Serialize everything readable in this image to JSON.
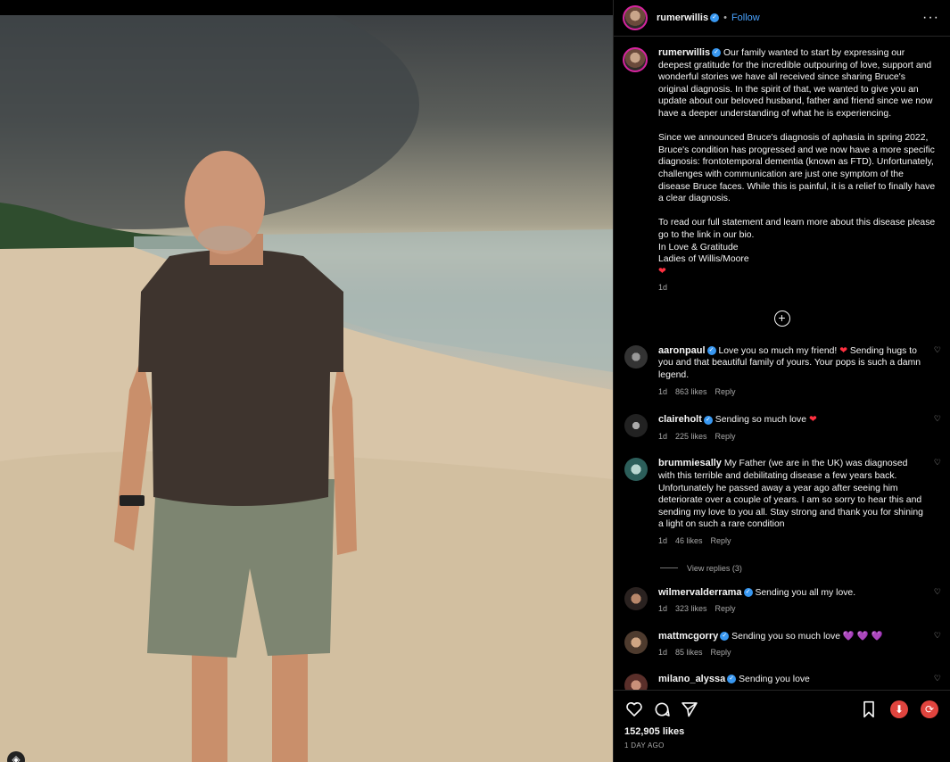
{
  "post": {
    "username": "rumerwillis",
    "follow_label": "Follow",
    "dot": "•",
    "more": "···",
    "caption_paragraphs": [
      "Our family wanted to start by expressing our deepest gratitude for the incredible outpouring of love, support and wonderful stories we have all received since sharing Bruce's original diagnosis. In the spirit of that, we wanted to give you an update about our beloved husband, father and friend since we now have a deeper understanding of what he is experiencing.",
      "Since we announced Bruce's diagnosis of aphasia in spring 2022, Bruce's condition has progressed and we now have a more specific diagnosis: frontotemporal dementia (known as FTD). Unfortunately, challenges with communication are just one symptom of the disease Bruce faces. While this is painful, it is a relief to finally have a clear diagnosis.",
      "To read our full statement and learn more about this disease please go to the link in our bio.\nIn Love & Gratitude\nLadies of Willis/Moore"
    ],
    "caption_heart": "❤",
    "caption_time": "1d",
    "likes": "152,905 likes",
    "time_ago": "1 DAY AGO"
  },
  "comments": [
    {
      "user": "aaronpaul",
      "verified": true,
      "text_a": "Love you so much my friend!",
      "emoji": "❤",
      "emoji_color": "#ff3040",
      "text_b": "Sending hugs to you and that beautiful family of yours. Your pops is such a damn legend.",
      "time": "1d",
      "likes": "863 likes",
      "reply": "Reply"
    },
    {
      "user": "claireholt",
      "verified": true,
      "text_a": "Sending so much love",
      "emoji": "❤",
      "emoji_color": "#ff3040",
      "text_b": "",
      "time": "1d",
      "likes": "225 likes",
      "reply": "Reply"
    },
    {
      "user": "brummiesally",
      "verified": false,
      "text_a": "My Father (we are in the UK) was diagnosed with this terrible and debilitating disease a few years back. Unfortunately he passed away a year ago after seeing him deteriorate over a couple of years. I am so sorry to hear this and sending my love to you all. Stay strong and thank you for shining a light on such a rare condition",
      "emoji": "",
      "emoji_color": "#ffffff",
      "text_b": "",
      "time": "1d",
      "likes": "46 likes",
      "reply": "Reply",
      "view_replies": "View replies (3)"
    },
    {
      "user": "wilmervalderrama",
      "verified": true,
      "text_a": "Sending you all my love.",
      "emoji": "",
      "emoji_color": "#ffffff",
      "text_b": "",
      "time": "1d",
      "likes": "323 likes",
      "reply": "Reply"
    },
    {
      "user": "mattmcgorry",
      "verified": true,
      "text_a": "Sending you so much love",
      "emoji": "💜 💜 💜",
      "emoji_color": "#a56bff",
      "text_b": "",
      "time": "1d",
      "likes": "85 likes",
      "reply": "Reply"
    },
    {
      "user": "milano_alyssa",
      "verified": true,
      "text_a": "Sending you love",
      "emoji": "",
      "emoji_color": "#ffffff",
      "text_b": "",
      "time": "",
      "likes": "",
      "reply": ""
    }
  ],
  "icons": {
    "verified": "verified-badge-icon",
    "add": "plus-circle-icon",
    "like": "heart-icon",
    "comment": "comment-icon",
    "share": "paper-plane-icon",
    "save": "bookmark-icon",
    "download": "download-icon",
    "refresh": "refresh-icon"
  },
  "colors": {
    "follow": "#4aa3ff",
    "verified": "#3897f0",
    "heart": "#ff3040"
  }
}
